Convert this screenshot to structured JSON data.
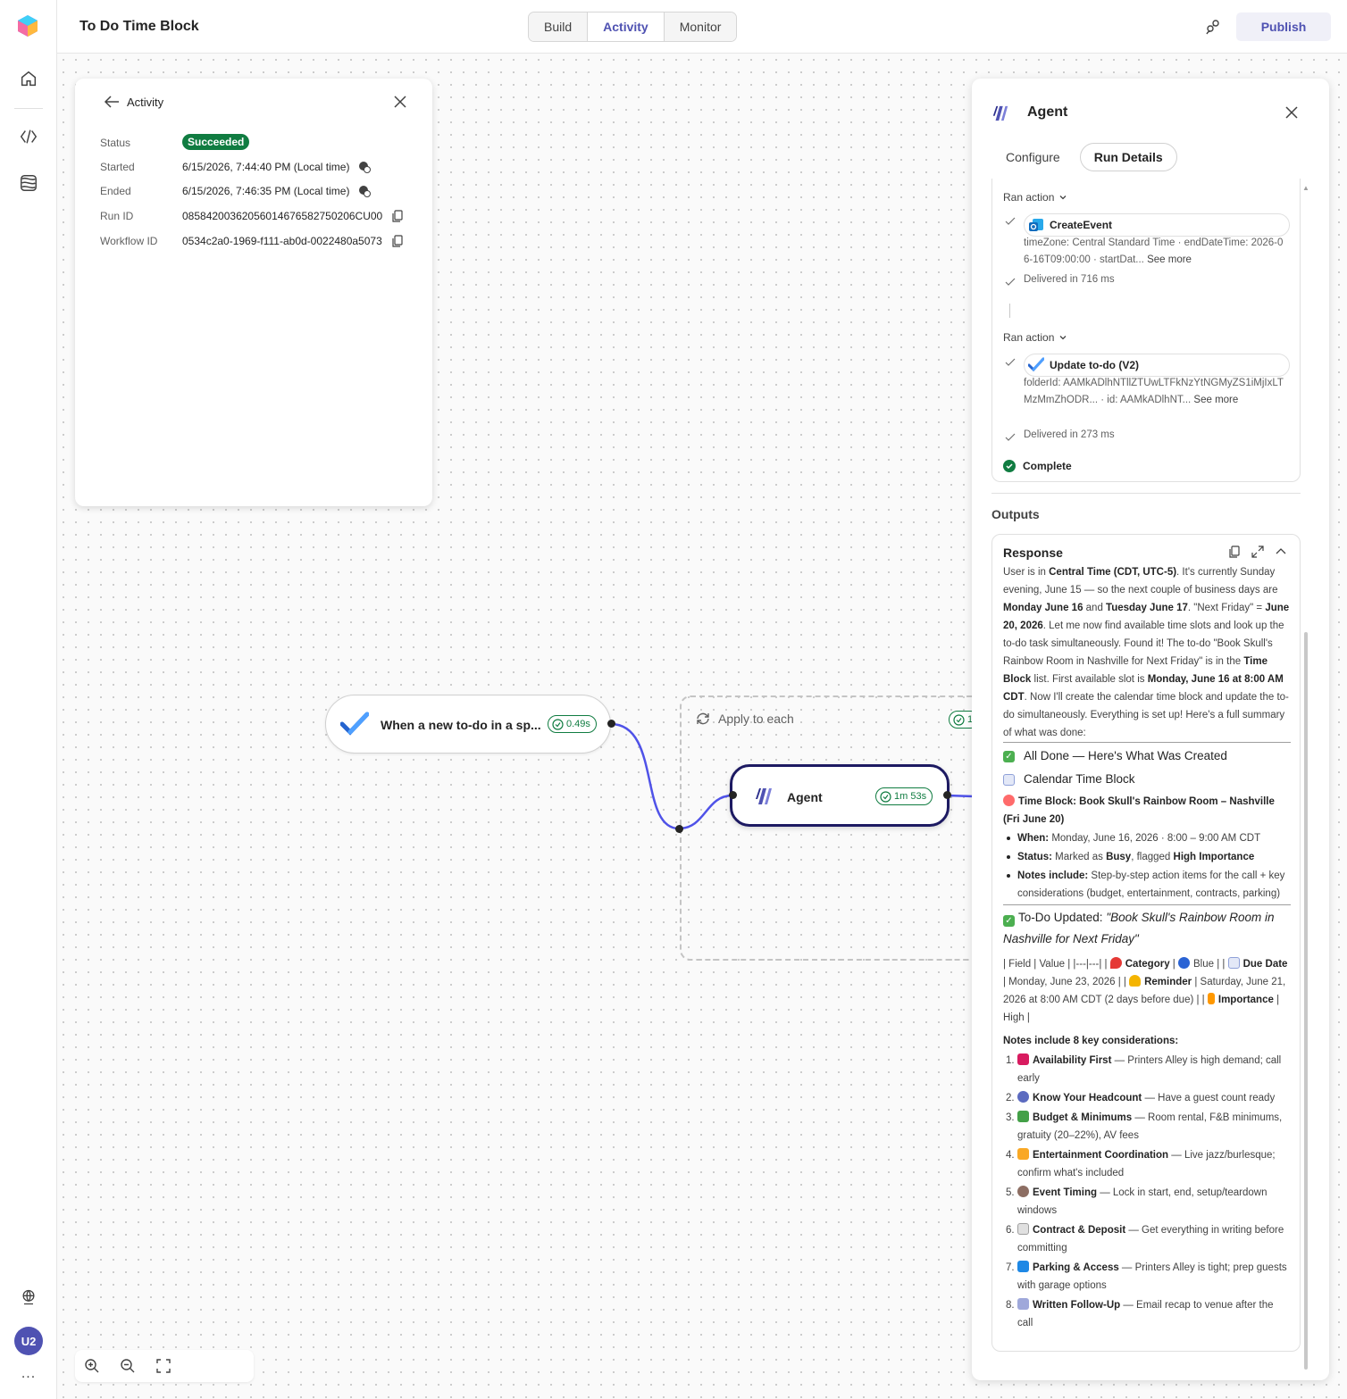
{
  "app": {
    "title": "To Do Time Block"
  },
  "tabs": [
    {
      "label": "Build",
      "active": false
    },
    {
      "label": "Activity",
      "active": true
    },
    {
      "label": "Monitor",
      "active": false
    }
  ],
  "header": {
    "publish_label": "Publish"
  },
  "rail": {
    "avatar_initials": "U2",
    "more": "..."
  },
  "activity": {
    "title": "Activity",
    "status_label": "Status",
    "status_value": "Succeeded",
    "started_label": "Started",
    "started_value": "6/15/2026, 7:44:40 PM (Local time)",
    "ended_label": "Ended",
    "ended_value": "6/15/2026, 7:46:35 PM (Local time)",
    "runid_label": "Run ID",
    "runid_value": "08584200362056014676582750206CU00",
    "workflowid_label": "Workflow ID",
    "workflowid_value": "0534c2a0-1969-f111-ab0d-0022480a5073"
  },
  "flow": {
    "trigger_label": "When a new to-do in a sp...",
    "trigger_duration": "0.49s",
    "loop_label": "Apply to each",
    "loop_duration": "1",
    "agent_label": "Agent",
    "agent_duration": "1m 53s"
  },
  "agent_panel": {
    "title": "Agent",
    "tab_configure": "Configure",
    "tab_run_details": "Run Details",
    "action1": {
      "ran_label": "Ran action",
      "name": "CreateEvent",
      "detail": "timeZone: Central Standard Time · endDateTime: 2026-06-16T09:00:00 · startDat...",
      "see_more": "See more",
      "delivered": "Delivered in 716 ms"
    },
    "action2": {
      "ran_label": "Ran action",
      "name": "Update to-do (V2)",
      "detail": "folderId: AAMkADlhNTllZTUwLTFkNzYtNGMyZS1iMjIxLTMzMmZhODR... · id: AAMkADlhNT...",
      "see_more": "See more",
      "delivered": "Delivered in 273 ms"
    },
    "complete_label": "Complete",
    "outputs_label": "Outputs",
    "response_title": "Response"
  },
  "response": {
    "p1": [
      "User is in ",
      "Central Time (CDT, UTC-5)",
      ". It's currently Sunday evening, June 15 — so the next couple of business days are ",
      "Monday June 16",
      " and ",
      "Tuesday June 17",
      ". \"Next Friday\" = ",
      "June 20, 2026",
      ". Let me now find available time slots and look up the to-do task simultaneously. Found it! The to-do \"Book Skull's Rainbow Room in Nashville for Next Friday\" is in the ",
      "Time Block",
      " list. First available slot is ",
      "Monday, June 16 at 8:00 AM CDT",
      ". Now I'll create the calendar time block and update the to-do simultaneously. Everything is set up! Here's a full summary of what was done:"
    ],
    "h_all_done": "All Done — Here's What Was Created",
    "h_calendar": "Calendar Time Block",
    "time_block_label": "Time Block: Book Skull's Rainbow Room – Nashville (Fri June 20)",
    "bullets": [
      {
        "label": "When:",
        "text": " Monday, June 16, 2026 · 8:00 – 9:00 AM CDT"
      },
      {
        "label": "Status:",
        "text": " Marked as ",
        "b2": "Busy",
        "text2": ", flagged ",
        "b3": "High Importance"
      },
      {
        "label": "Notes include:",
        "text": " Step-by-step action items for the call + key considerations (budget, entertainment, contracts, parking)"
      }
    ],
    "h_todo_prefix": "To-Do Updated: ",
    "h_todo_title": "\"Book Skull's Rainbow Room in Nashville for Next Friday\"",
    "table_line": {
      "t1": "| Field | Value | |---|---| | ",
      "category": "Category",
      "t2": " | ",
      "blue": "Blue",
      "t3": " | | ",
      "due": "Due Date",
      "t4": " | Monday, June 23, 2026 | | ",
      "reminder": "Reminder",
      "t5": " | Saturday, June 21, 2026 at 8:00 AM CDT (2 days before due) | | ",
      "importance": "Importance",
      "t6": " | High |"
    },
    "notes_heading": "Notes include 8 key considerations:",
    "considerations": [
      {
        "num": "1.",
        "icon": "phone-icon",
        "title": "Availability First",
        "text": " — Printers Alley is high demand; call early"
      },
      {
        "num": "2.",
        "icon": "people-icon",
        "title": "Know Your Headcount",
        "text": " — Have a guest count ready"
      },
      {
        "num": "3.",
        "icon": "money-icon",
        "title": "Budget & Minimums",
        "text": " — Room rental, F&B minimums, gratuity (20–22%), AV fees"
      },
      {
        "num": "4.",
        "icon": "mask-icon",
        "title": "Entertainment Coordination",
        "text": " — Live jazz/burlesque; confirm what's included"
      },
      {
        "num": "5.",
        "icon": "timer-icon",
        "title": "Event Timing",
        "text": " — Lock in start, end, setup/teardown windows"
      },
      {
        "num": "6.",
        "icon": "document-icon",
        "title": "Contract & Deposit",
        "text": " — Get everything in writing before committing"
      },
      {
        "num": "7.",
        "icon": "parking-icon",
        "title": "Parking & Access",
        "text": " — Printers Alley is tight; prep guests with garage options"
      },
      {
        "num": "8.",
        "icon": "mail-icon",
        "title": "Written Follow-Up",
        "text": " — Email recap to venue after the call"
      }
    ]
  }
}
